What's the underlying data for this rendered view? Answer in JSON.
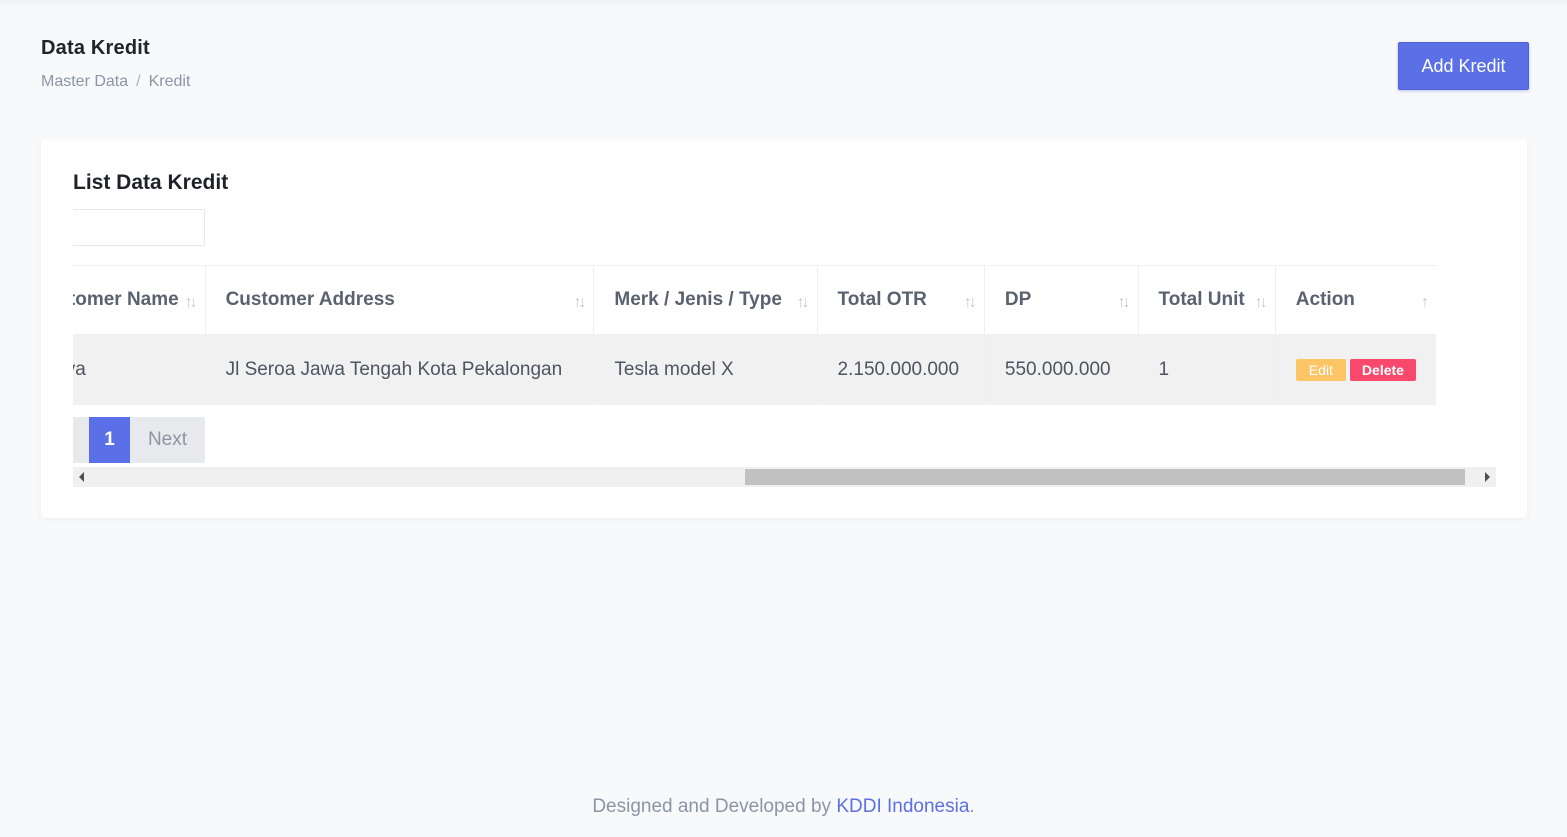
{
  "header": {
    "title": "Data Kredit",
    "breadcrumb": [
      "Master Data",
      "Kredit"
    ],
    "breadcrumb_separator": "/",
    "add_button": "Add Kredit"
  },
  "card": {
    "title": "List Data Kredit",
    "search": {
      "value": "",
      "placeholder": ""
    }
  },
  "table": {
    "columns": [
      "Customer Name",
      "Customer Address",
      "Merk / Jenis / Type",
      "Total OTR",
      "DP",
      "Total Unit",
      "Action"
    ],
    "visible_first_column_text": "omer Name",
    "sort_icon": "↑↓",
    "rows": [
      {
        "customer_name": "Aditya",
        "customer_address": "Jl Seroa Jawa Tengah Kota Pekalongan",
        "merk": "Tesla model X",
        "total_otr": "2.150.000.000",
        "dp": "550.000.000",
        "total_unit": "1",
        "edit_label": "Edit",
        "delete_label": "Delete"
      }
    ]
  },
  "pagination": {
    "current": "1",
    "next": "Next"
  },
  "footer": {
    "text": "Designed and Developed by ",
    "brand": "KDDI Indonesia",
    "suffix": "."
  },
  "colors": {
    "primary": "#5b6fe6",
    "edit": "#fbc566",
    "delete": "#f8486c",
    "background": "#f8f9fb"
  }
}
